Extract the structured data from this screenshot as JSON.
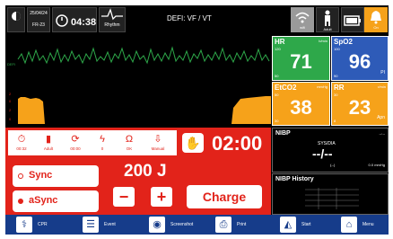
{
  "topbar": {
    "date": "25/04/24",
    "weekday": "FR-23",
    "timer": "04:38",
    "rhythm_label": "Rhythm",
    "title": "DEFI: VF / VT",
    "wifi_label": "wifi",
    "patient_label": "Adult",
    "alarm_label": "On"
  },
  "waveform": {
    "lead_label": "DEFI",
    "scale": [
      "2",
      "0",
      "2",
      "0"
    ]
  },
  "vitals": {
    "hr": {
      "label": "HR",
      "unit": "b/min",
      "hi": "120",
      "lo": "50",
      "value": "71"
    },
    "spo2": {
      "label": "SpO2",
      "unit": "",
      "hi": "100",
      "lo": "90",
      "value": "96",
      "suffix": "PI"
    },
    "etco2": {
      "label": "EtCO2",
      "unit": "mmHg",
      "hi": "50",
      "lo": "30",
      "value": "38"
    },
    "rr": {
      "label": "RR",
      "unit": "r/min",
      "hi": "30",
      "lo": "8",
      "value": "23",
      "suffix": "Apn"
    }
  },
  "defib": {
    "tools": [
      {
        "label": "00:32",
        "icon": "stopwatch-icon"
      },
      {
        "label": "Adult",
        "icon": "pads-icon"
      },
      {
        "label": "00:00",
        "icon": "rotate-icon"
      },
      {
        "label": "0",
        "icon": "bolt-icon"
      },
      {
        "label": "OK",
        "icon": "impedance-icon"
      },
      {
        "label": "Manual",
        "icon": "manual-icon"
      }
    ],
    "cpr_timer": "02:00",
    "sync_label": "Sync",
    "async_label": "aSync",
    "energy": "200 J",
    "minus_label": "−",
    "plus_label": "+",
    "charge_label": "Charge"
  },
  "nibp": {
    "label": "NIBP",
    "time": "--:--",
    "sys_dia": "SYS/DIA",
    "value": "--/--",
    "map": "(--)",
    "unit": "0.0 mmHg"
  },
  "nibp_history": {
    "label": "NIBP History"
  },
  "bottombar": {
    "cpr": "CPR",
    "event": "Event",
    "screenshot": "Screenshot",
    "print": "Print",
    "start": "Start",
    "menu": "Menu"
  },
  "colors": {
    "accent": "#e2231a",
    "hr": "#2ea84a",
    "spo2": "#2e5bb8",
    "etco2": "#f6a21a",
    "bar": "#163c8a"
  }
}
